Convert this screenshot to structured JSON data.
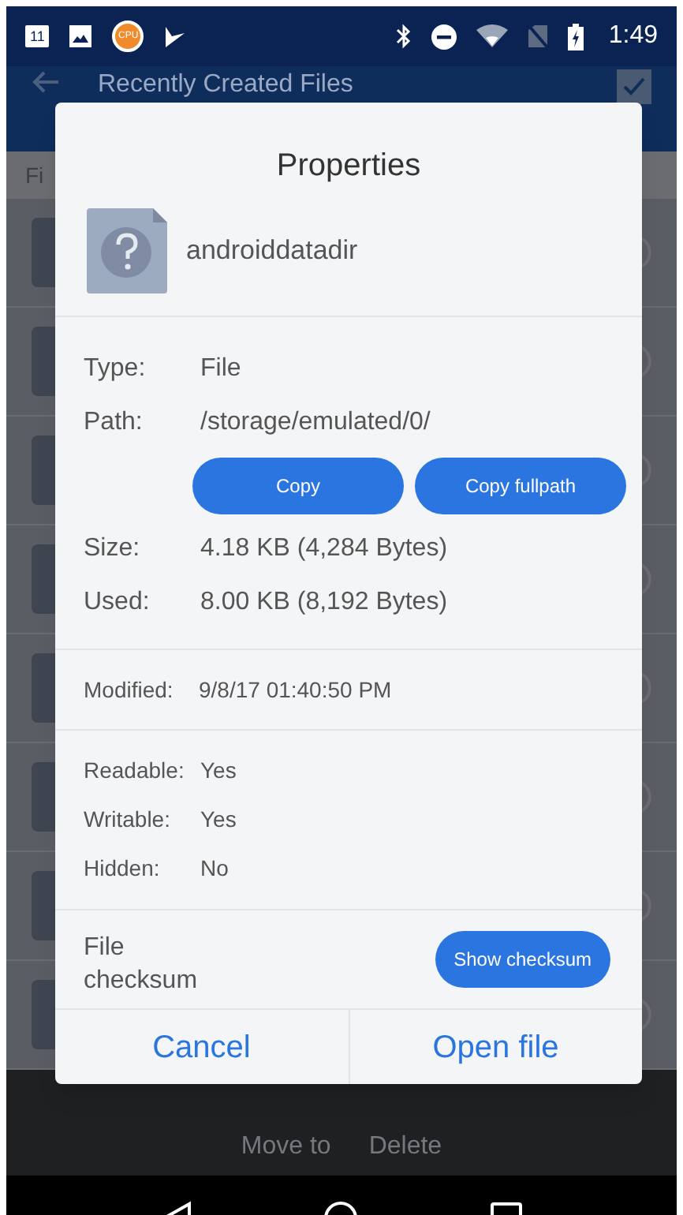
{
  "status_bar": {
    "notification_badge": "11",
    "cpu_badge": "CPU",
    "time": "1:49"
  },
  "app_bar": {
    "title": "Recently Created Files"
  },
  "list_header": "Fi",
  "dialog": {
    "title": "Properties",
    "file_name": "androiddatadir",
    "info": [
      {
        "label": "Type:",
        "value": "File"
      },
      {
        "label": "Path:",
        "value": "/storage/emulated/0/"
      }
    ],
    "path_buttons": [
      "Copy",
      "Copy fullpath"
    ],
    "sizes": [
      {
        "label": "Size:",
        "value": "4.18 KB (4,284 Bytes)"
      },
      {
        "label": "Used:",
        "value": "8.00 KB (8,192 Bytes)"
      }
    ],
    "modified": {
      "label": "Modified:",
      "value": "9/8/17 01:40:50 PM"
    },
    "attributes": [
      {
        "label": "Readable:",
        "value": "Yes"
      },
      {
        "label": "Writable:",
        "value": "Yes"
      },
      {
        "label": "Hidden:",
        "value": "No"
      }
    ],
    "checksum": {
      "label": "File checksum",
      "button": "Show checksum"
    },
    "actions": [
      "Cancel",
      "Open file"
    ]
  },
  "bottom_bar": [
    "Move to",
    "Delete"
  ]
}
